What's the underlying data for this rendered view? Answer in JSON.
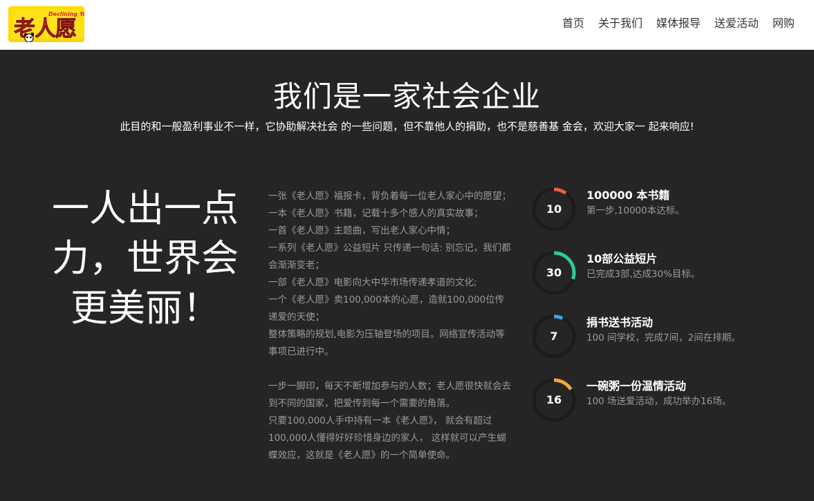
{
  "brand": {
    "logo_text": "老人愿",
    "logo_subtext": "Declining Years"
  },
  "nav": {
    "items": [
      {
        "label": "首页"
      },
      {
        "label": "关于我们"
      },
      {
        "label": "媒体报导"
      },
      {
        "label": "送爱活动"
      },
      {
        "label": "网购"
      }
    ]
  },
  "hero": {
    "title": "我们是一家社会企业",
    "subtitle": "此目的和一般盈利事业不一样，它协助解决社会 的一些问题，但不靠他人的捐助，也不是慈善基 金会，欢迎大家一 起来响应!"
  },
  "slogan": {
    "lines": [
      "一人出一点",
      "力，世界会",
      "更美丽！"
    ]
  },
  "story": {
    "paragraphs": [
      "一张《老人愿》福报卡，背负着每一位老人家心中的愿望；",
      "一本《老人愿》书籍，记载十多个感人的真实故事；",
      "一首《老人愿》主题曲，写出老人家心中情；",
      "一系列《老人愿》公益短片 只传递一句话: 别忘记，我们都会渐渐变老；",
      "一部《老人愿》电影向大中华市场传递孝道的文化;",
      "一个《老人愿》卖100,000本的心愿，造就100,000位传递爱的天使；",
      "整体策略的规划,电影为压轴登场的项目。网络宣传活动等事项已进行中。",
      "",
      "一步一脚印，每天不断增加参与的人数；老人愿很快就会去到不同的国家，把爱传到每一个需要的角落。",
      "只要100,000人手中持有一本《老人愿》， 就会有超过100,000人懂得好好珍惜身边的家人， 这样就可以产生蝴蝶效应，这就是《老人愿》的一个简单使命。"
    ]
  },
  "stats": [
    {
      "value": "10",
      "title": "100000 本书籍",
      "desc": "第一步,10000本达标。",
      "percent": 10,
      "color": "#e85d4a"
    },
    {
      "value": "30",
      "title": "10部公益短片",
      "desc": "已完成3部,达成30%目标。",
      "percent": 30,
      "color": "#2ecc8f"
    },
    {
      "value": "7",
      "title": "捐书送书活动",
      "desc": "100 间学校，完成7间，2间在排期。",
      "percent": 7,
      "color": "#3aa8e0"
    },
    {
      "value": "16",
      "title": "一碗粥一份温情活动",
      "desc": "100 场送爱活动，成功举办16场。",
      "percent": 16,
      "color": "#f0a93a"
    }
  ]
}
